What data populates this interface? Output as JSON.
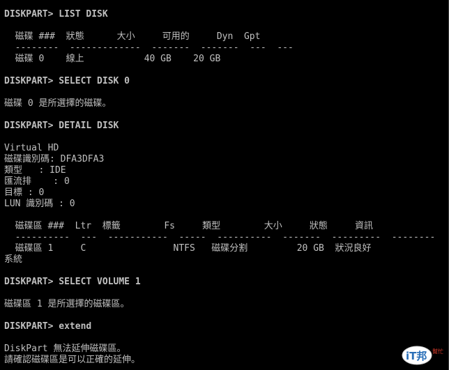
{
  "console": {
    "cmd_list_disk": "DISKPART> LIST DISK",
    "disk_table_header": "  磁碟 ###  狀態      大小     可用的     Dyn  Gpt",
    "disk_table_sep": "  --------  -------------  -------  -------  ---  ---",
    "disk_table_row": "  磁碟 0    線上           40 GB    20 GB",
    "cmd_select_disk": "DISKPART> SELECT DISK 0",
    "msg_disk_selected": "磁碟 0 是所選擇的磁碟。",
    "cmd_detail_disk": "DISKPART> DETAIL DISK",
    "detail_name": "Virtual HD",
    "detail_id": "磁碟識別碼: DFA3DFA3",
    "detail_type": "類型   : IDE",
    "detail_bus": "匯流排    : 0",
    "detail_target": "目標 : 0",
    "detail_lun": "LUN 識別碼 : 0",
    "volume_table_header": "  磁碟區 ###  Ltr  標籤        Fs     類型        大小     狀態     資訊",
    "volume_table_sep": "  ----------  ---  -----------  -----  ----------  -------  ---------  --------",
    "volume_table_row": "  磁碟區 1     C                NTFS   磁碟分割         20 GB  狀況良好",
    "volume_table_row_cont": "系統",
    "cmd_select_volume": "DISKPART> SELECT VOLUME 1",
    "msg_volume_selected": "磁碟區 1 是所選擇的磁碟區。",
    "cmd_extend": "DISKPART> extend",
    "err_extend_1": "DiskPart 無法延伸磁碟區。",
    "err_extend_2": "請確認磁碟區是可以正確的延伸。"
  },
  "watermark": {
    "brand_primary": "iT邦",
    "brand_secondary": "幫忙"
  },
  "colors": {
    "background": "#000000",
    "text": "#c0c0c0",
    "logo_blue": "#2a6fb8",
    "logo_red": "#d83a2a"
  }
}
